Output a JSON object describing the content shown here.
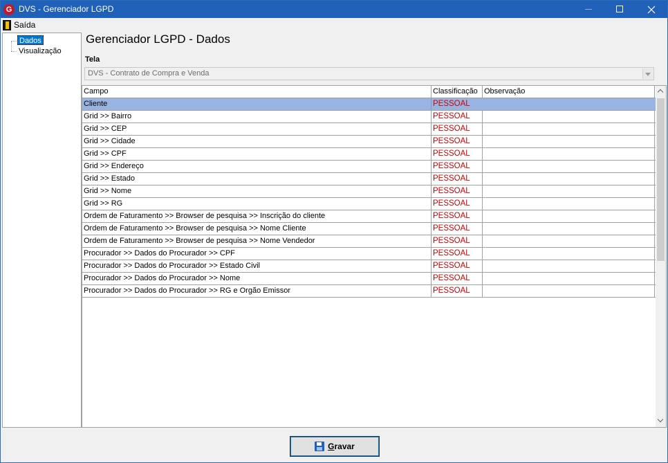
{
  "window": {
    "title": "DVS - Gerenciador LGPD",
    "app_icon_letter": "G"
  },
  "menu": {
    "items": [
      {
        "label": "Saída",
        "icon": "exit-door-icon"
      }
    ]
  },
  "tree": {
    "items": [
      {
        "label": "Dados",
        "selected": true
      },
      {
        "label": "Visualização",
        "selected": false
      }
    ]
  },
  "main": {
    "title": "Gerenciador LGPD - Dados",
    "tela_label": "Tela",
    "tela_value": "DVS - Contrato de Compra e Venda"
  },
  "grid": {
    "columns": [
      "Campo",
      "Classificação",
      "Observação"
    ],
    "rows": [
      {
        "campo": "Cliente",
        "classificacao": "PESSOAL",
        "observacao": "",
        "selected": true
      },
      {
        "campo": "Grid >> Bairro",
        "classificacao": "PESSOAL",
        "observacao": ""
      },
      {
        "campo": "Grid >> CEP",
        "classificacao": "PESSOAL",
        "observacao": ""
      },
      {
        "campo": "Grid >> Cidade",
        "classificacao": "PESSOAL",
        "observacao": ""
      },
      {
        "campo": "Grid >> CPF",
        "classificacao": "PESSOAL",
        "observacao": ""
      },
      {
        "campo": "Grid >> Endereço",
        "classificacao": "PESSOAL",
        "observacao": ""
      },
      {
        "campo": "Grid >> Estado",
        "classificacao": "PESSOAL",
        "observacao": ""
      },
      {
        "campo": "Grid >> Nome",
        "classificacao": "PESSOAL",
        "observacao": ""
      },
      {
        "campo": "Grid >> RG",
        "classificacao": "PESSOAL",
        "observacao": ""
      },
      {
        "campo": "Ordem de Faturamento >> Browser de pesquisa >> Inscrição do cliente",
        "classificacao": "PESSOAL",
        "observacao": ""
      },
      {
        "campo": "Ordem de Faturamento >> Browser de pesquisa >> Nome Cliente",
        "classificacao": "PESSOAL",
        "observacao": ""
      },
      {
        "campo": "Ordem de Faturamento >> Browser de pesquisa >> Nome Vendedor",
        "classificacao": "PESSOAL",
        "observacao": ""
      },
      {
        "campo": "Procurador >> Dados do Procurador >> CPF",
        "classificacao": "PESSOAL",
        "observacao": ""
      },
      {
        "campo": "Procurador >> Dados do Procurador >> Estado Civil",
        "classificacao": "PESSOAL",
        "observacao": ""
      },
      {
        "campo": "Procurador >> Dados do Procurador >> Nome",
        "classificacao": "PESSOAL",
        "observacao": ""
      },
      {
        "campo": "Procurador >> Dados do Procurador >> RG e Orgão Emissor",
        "classificacao": "PESSOAL",
        "observacao": ""
      }
    ]
  },
  "footer": {
    "save_button": {
      "label_first": "G",
      "label_rest": "ravar",
      "icon": "floppy-disk-icon"
    }
  },
  "colors": {
    "titlebar": "#2160b8",
    "selection": "#99b4e1",
    "classification_text": "#d00000"
  }
}
